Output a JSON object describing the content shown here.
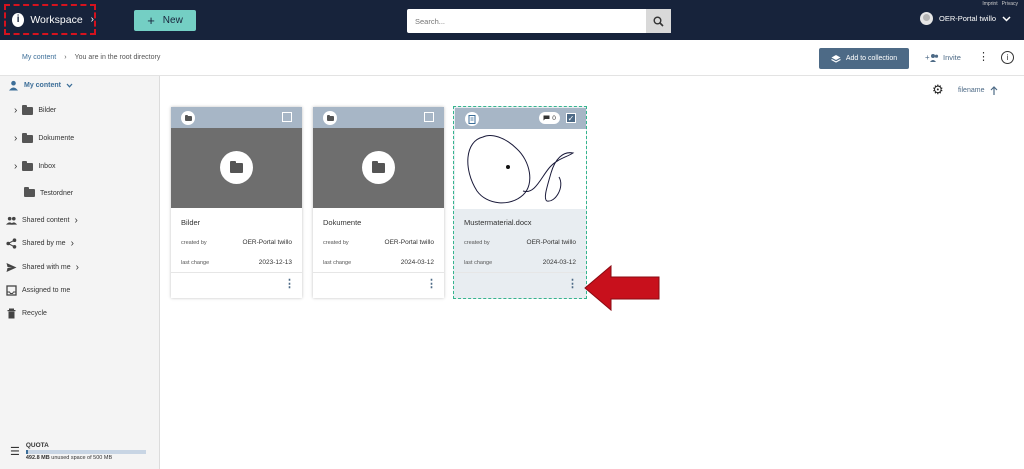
{
  "header": {
    "workspace_label": "Workspace",
    "new_label": "New",
    "search_placeholder": "Search...",
    "links": [
      "Imprint",
      "Privacy"
    ],
    "user_name": "OER-Portal twillo"
  },
  "subbar": {
    "breadcrumb_root": "My content",
    "breadcrumb_current": "You are in the root directory",
    "add_collection_label": "Add to collection",
    "invite_label": "Invite"
  },
  "sidebar": {
    "my_content": "My content",
    "folders": [
      {
        "label": "Bilder"
      },
      {
        "label": "Dokumente"
      },
      {
        "label": "Inbox"
      },
      {
        "label": "Testordner"
      }
    ],
    "items": [
      {
        "label": "Shared content"
      },
      {
        "label": "Shared by me"
      },
      {
        "label": "Shared with me"
      },
      {
        "label": "Assigned to me"
      },
      {
        "label": "Recycle"
      }
    ],
    "quota": {
      "title": "QUOTA",
      "used": "492.8 MB",
      "rest": "unused space of 500 MB",
      "used_fraction": 0.014
    }
  },
  "sort": {
    "label": "filename"
  },
  "cards": [
    {
      "name": "Bilder",
      "created_label": "created by",
      "created_by": "OER-Portal twillo",
      "changed_label": "last change",
      "last_change": "2023-12-13"
    },
    {
      "name": "Dokumente",
      "created_label": "created by",
      "created_by": "OER-Portal twillo",
      "changed_label": "last change",
      "last_change": "2024-03-12"
    },
    {
      "name": "Mustermaterial.docx",
      "created_label": "created by",
      "created_by": "OER-Portal twillo",
      "changed_label": "last change",
      "last_change": "2024-03-12",
      "comments": "0"
    }
  ],
  "colors": {
    "header_bg": "#17233b",
    "accent": "#74cfc4",
    "primary": "#4d6a86",
    "highlight_red": "#d5121e",
    "selection_green": "#35b58e"
  }
}
